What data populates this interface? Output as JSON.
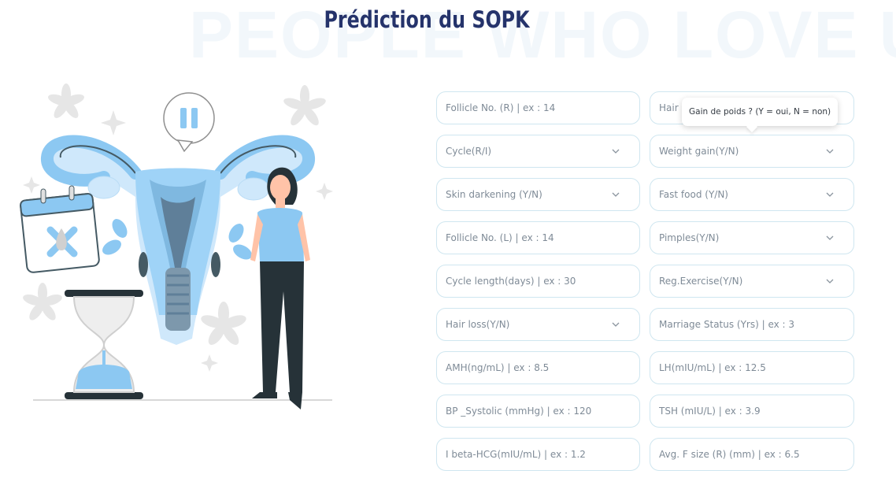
{
  "background_text": "PEOPLE WHO LOVE US",
  "title": "Prédiction du SOPK",
  "tooltip": "Gain de poids ? (Y = oui, N = non)",
  "colors": {
    "title": "#25336b",
    "field_border": "#cfe6f0",
    "illustration_blue": "#8cc8f2",
    "illustration_dark": "#263238"
  },
  "fields": [
    {
      "name": "follicle-no-r-input",
      "label": "Follicle No. (R) | ex : 14",
      "type": "input"
    },
    {
      "name": "hair-growth-select",
      "label": "Hair growth(Y/N)",
      "type": "select"
    },
    {
      "name": "cycle-select",
      "label": "Cycle(R/I)",
      "type": "select"
    },
    {
      "name": "weight-gain-select",
      "label": "Weight gain(Y/N)",
      "type": "select"
    },
    {
      "name": "skin-darkening-select",
      "label": "Skin darkening (Y/N)",
      "type": "select"
    },
    {
      "name": "fast-food-select",
      "label": "Fast food (Y/N)",
      "type": "select"
    },
    {
      "name": "follicle-no-l-input",
      "label": "Follicle No. (L) | ex : 14",
      "type": "input"
    },
    {
      "name": "pimples-select",
      "label": "Pimples(Y/N)",
      "type": "select"
    },
    {
      "name": "cycle-length-input",
      "label": "Cycle length(days) | ex : 30",
      "type": "input"
    },
    {
      "name": "reg-exercise-select",
      "label": "Reg.Exercise(Y/N)",
      "type": "select"
    },
    {
      "name": "hair-loss-select",
      "label": "Hair loss(Y/N)",
      "type": "select"
    },
    {
      "name": "marriage-status-input",
      "label": "Marriage Status (Yrs) | ex : 3",
      "type": "input"
    },
    {
      "name": "amh-input",
      "label": "AMH(ng/mL) | ex : 8.5",
      "type": "input"
    },
    {
      "name": "lh-input",
      "label": "LH(mIU/mL) | ex : 12.5",
      "type": "input"
    },
    {
      "name": "bp-systolic-input",
      "label": "BP _Systolic (mmHg) | ex : 120",
      "type": "input"
    },
    {
      "name": "tsh-input",
      "label": "TSH (mIU/L) | ex : 3.9",
      "type": "input"
    },
    {
      "name": "beta-hcg-input",
      "label": "I beta-HCG(mIU/mL) | ex : 1.2",
      "type": "input"
    },
    {
      "name": "avg-f-size-r-input",
      "label": "Avg. F size (R) (mm) | ex : 6.5",
      "type": "input"
    }
  ]
}
